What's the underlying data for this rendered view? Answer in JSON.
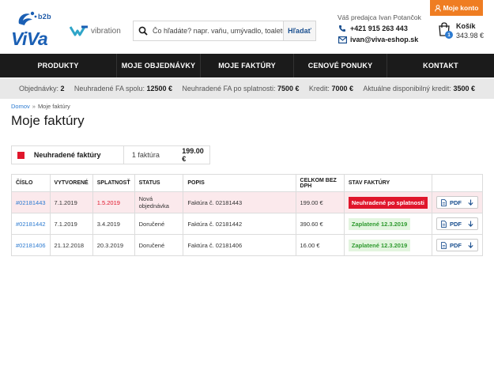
{
  "brand": {
    "b2b": "b2b",
    "name": "ViVa",
    "partner": "vibration"
  },
  "search": {
    "placeholder": "Čo hľadáte? napr. vaňu, umývadlo, toaletu",
    "button": "Hľadať"
  },
  "contact": {
    "seller_label": "Váš predajca Ivan Potančok",
    "phone": "+421 915 263 443",
    "email": "ivan@viva-eshop.sk"
  },
  "account": {
    "label": "Moje konto"
  },
  "cart": {
    "label": "Košík",
    "count": "1",
    "amount": "343.98 €"
  },
  "nav": [
    {
      "label": "PRODUKTY"
    },
    {
      "label": "MOJE OBJEDNÁVKY"
    },
    {
      "label": "MOJE FAKTÚRY"
    },
    {
      "label": "CENOVÉ PONUKY"
    },
    {
      "label": "KONTAKT"
    }
  ],
  "stats": [
    {
      "label": "Objednávky:",
      "value": "2"
    },
    {
      "label": "Neuhradené FA spolu:",
      "value": "12500 €"
    },
    {
      "label": "Neuhradené FA po splatnosti:",
      "value": "7500 €"
    },
    {
      "label": "Kredit:",
      "value": "7000 €"
    },
    {
      "label": "Aktuálne disponibilný kredit:",
      "value": "3500 €"
    }
  ],
  "breadcrumb": {
    "home": "Domov",
    "separator": "»",
    "current": "Moje faktúry"
  },
  "page_title": "Moje faktúry",
  "summary": {
    "label": "Neuhradené faktúry",
    "count": "1 faktúra",
    "total": "199.00 €"
  },
  "table": {
    "headers": [
      "ČÍSLO",
      "VYTVORENÉ",
      "SPLATNOSŤ",
      "STATUS",
      "POPIS",
      "CELKOM BEZ DPH",
      "STAV FAKTÚRY",
      ""
    ],
    "pdf_label": "PDF",
    "rows": [
      {
        "number": "#02181443",
        "created": "7.1.2019",
        "due": "1.5.2019",
        "status": "Nová objednávka",
        "description": "Faktúra č. 02181443",
        "total": "199.00 €",
        "state": "Neuhradené po splatnosti"
      },
      {
        "number": "#02181442",
        "created": "7.1.2019",
        "due": "3.4.2019",
        "status": "Doručené",
        "description": "Faktúra č. 02181442",
        "total": "390.60 €",
        "state": "Zaplatené 12.3.2019"
      },
      {
        "number": "#02181406",
        "created": "21.12.2018",
        "due": "20.3.2019",
        "status": "Doručené",
        "description": "Faktúra č. 02181406",
        "total": "16.00 €",
        "state": "Zaplatené 12.3.2019"
      }
    ]
  },
  "colors": {
    "brand_blue": "#1a5fb4",
    "accent_orange": "#ef7d22",
    "nav_bg": "#1b1b1b",
    "danger_red": "#e0162b",
    "paid_green": "#2f9a2f",
    "link_blue": "#2d7bd1"
  }
}
